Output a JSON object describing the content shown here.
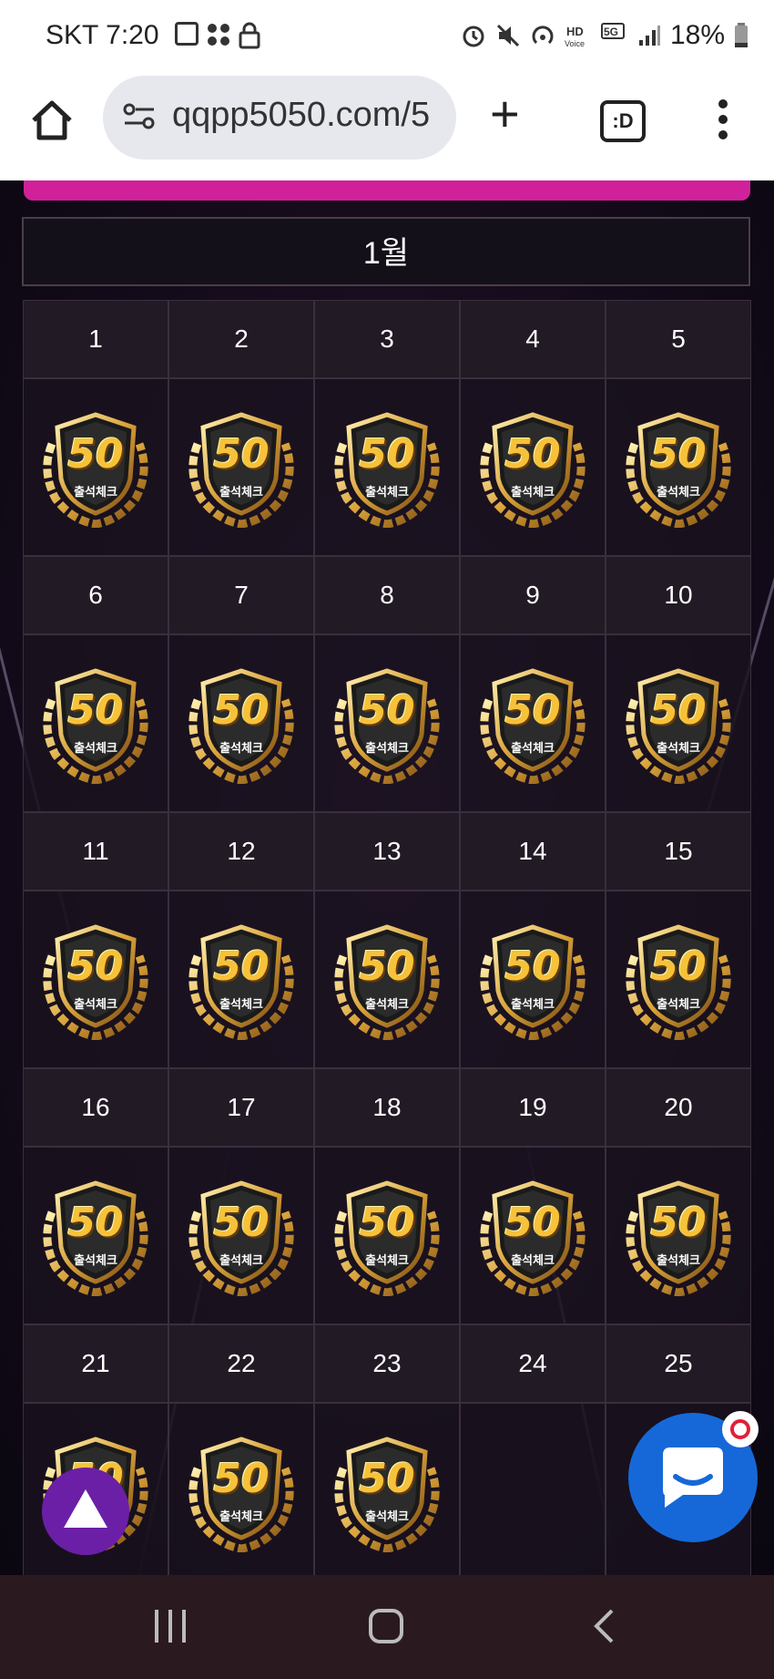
{
  "status_bar": {
    "carrier": "SKT",
    "time": "7:20",
    "battery": "18%",
    "icons": [
      "gallery-icon",
      "slack-icon",
      "lock-icon",
      "alarm-icon",
      "mute-icon",
      "hotspot-icon",
      "hd-voice-icon",
      "5g-icon",
      "signal-icon",
      "battery-icon"
    ]
  },
  "browser": {
    "url": "qqpp5050.com/5",
    "tab_label": ":D"
  },
  "calendar": {
    "month": "1월",
    "badge_number": "50",
    "badge_label": "출석체크",
    "days": [
      {
        "day": "1",
        "checked": true
      },
      {
        "day": "2",
        "checked": true
      },
      {
        "day": "3",
        "checked": true
      },
      {
        "day": "4",
        "checked": true
      },
      {
        "day": "5",
        "checked": true
      },
      {
        "day": "6",
        "checked": true
      },
      {
        "day": "7",
        "checked": true
      },
      {
        "day": "8",
        "checked": true
      },
      {
        "day": "9",
        "checked": true
      },
      {
        "day": "10",
        "checked": true
      },
      {
        "day": "11",
        "checked": true
      },
      {
        "day": "12",
        "checked": true
      },
      {
        "day": "13",
        "checked": true
      },
      {
        "day": "14",
        "checked": true
      },
      {
        "day": "15",
        "checked": true
      },
      {
        "day": "16",
        "checked": true
      },
      {
        "day": "17",
        "checked": true
      },
      {
        "day": "18",
        "checked": true
      },
      {
        "day": "19",
        "checked": true
      },
      {
        "day": "20",
        "checked": true
      },
      {
        "day": "21",
        "checked": true
      },
      {
        "day": "22",
        "checked": true
      },
      {
        "day": "23",
        "checked": true
      },
      {
        "day": "24",
        "checked": false
      },
      {
        "day": "25",
        "checked": false
      }
    ]
  },
  "colors": {
    "accent": "#d0219a",
    "chat_button": "#1668d8",
    "scroll_button": "#6b1fa6",
    "badge_gold": "#f6c23a"
  }
}
